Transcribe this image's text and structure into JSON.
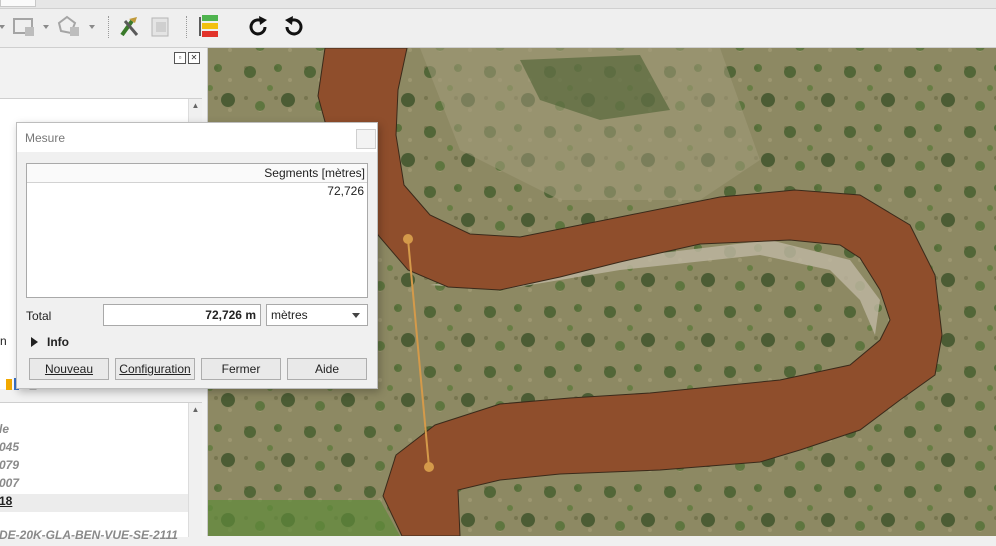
{
  "toolbar": {
    "icons": [
      "select-dropdown-icon",
      "deselect-layer-icon",
      "deselect-feature-icon",
      "plugin-tools-icon",
      "print-layout-icon",
      "layer-order-icon",
      "redo-icon",
      "undo-icon"
    ]
  },
  "left_panel": {
    "partial_label": "n",
    "rows": [
      "le",
      "045",
      "079",
      "007",
      "18",
      "DE-20K-GLA-BEN-VUE-SE-2111"
    ],
    "selected_index": 4
  },
  "dialog": {
    "title": "Mesure",
    "column_header": "Segments [mètres]",
    "segments": [
      "72,726"
    ],
    "total_label": "Total",
    "total_value": "72,726 m",
    "unit": "mètres",
    "info_label": "Info",
    "buttons": {
      "new": "Nouveau",
      "config": "Configuration",
      "close": "Fermer",
      "help": "Aide"
    }
  },
  "colors": {
    "river_fill": "#8f4e2c",
    "measure_line": "#d49a4a",
    "land": "#8c8a5e"
  }
}
